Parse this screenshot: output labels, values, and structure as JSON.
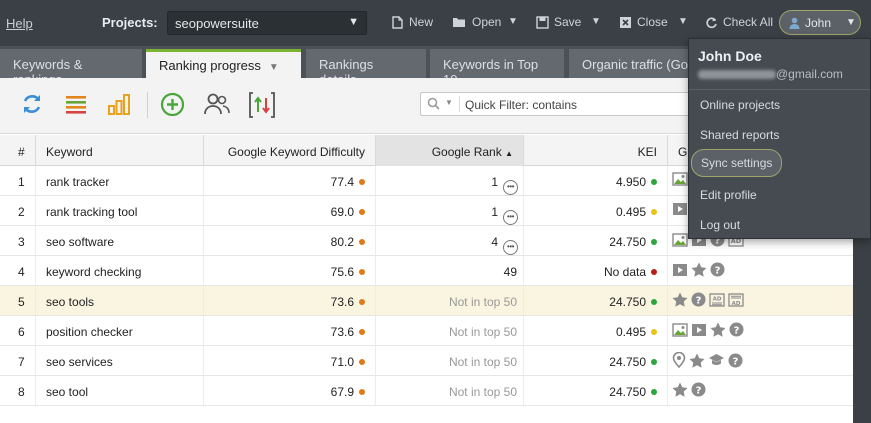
{
  "topbar": {
    "help": "Help",
    "projects_label": "Projects:",
    "project_value": "seopowersuite",
    "new": "New",
    "open": "Open",
    "save": "Save",
    "close": "Close",
    "check_all": "Check All",
    "user": "John"
  },
  "tabs": [
    {
      "label": "Keywords & rankings"
    },
    {
      "label": "Ranking progress"
    },
    {
      "label": "Rankings details"
    },
    {
      "label": "Keywords in Top 10"
    },
    {
      "label": "Organic traffic (Goo"
    }
  ],
  "filter": {
    "placeholder": "Quick Filter: contains"
  },
  "columns": {
    "num": "#",
    "keyword": "Keyword",
    "difficulty": "Google Keyword Difficulty",
    "rank": "Google Rank",
    "kei": "KEI",
    "serp": "G"
  },
  "rows": [
    {
      "n": "1",
      "keyword": "rank tracker",
      "difficulty": "77.4",
      "rank": "1",
      "kei": "4.950"
    },
    {
      "n": "2",
      "keyword": "rank tracking tool",
      "difficulty": "69.0",
      "rank": "1",
      "kei": "0.495"
    },
    {
      "n": "3",
      "keyword": "seo software",
      "difficulty": "80.2",
      "rank": "4",
      "kei": "24.750"
    },
    {
      "n": "4",
      "keyword": "keyword checking",
      "difficulty": "75.6",
      "rank": "49",
      "kei": "No data"
    },
    {
      "n": "5",
      "keyword": "seo tools",
      "difficulty": "73.6",
      "rank": "Not in top 50",
      "kei": "24.750"
    },
    {
      "n": "6",
      "keyword": "position checker",
      "difficulty": "73.6",
      "rank": "Not in top 50",
      "kei": "0.495"
    },
    {
      "n": "7",
      "keyword": "seo services",
      "difficulty": "71.0",
      "rank": "Not in top 50",
      "kei": "24.750"
    },
    {
      "n": "8",
      "keyword": "seo tool",
      "difficulty": "67.9",
      "rank": "Not in top 50",
      "kei": "24.750"
    }
  ],
  "row_status": {
    "kei_colors": [
      "#2aa63a",
      "#e8c21a",
      "#2aa63a",
      "#b81d1d",
      "#2aa63a",
      "#e8c21a",
      "#2aa63a",
      "#2aa63a"
    ],
    "difficulty_color": "#e07a16",
    "highlighted_row": 5
  },
  "serp_features": [
    [
      "image-icon"
    ],
    [
      "video-icon"
    ],
    [
      "image-icon",
      "video-icon",
      "question-icon",
      "ad-icon"
    ],
    [
      "video-icon",
      "star-icon",
      "question-icon"
    ],
    [
      "star-icon",
      "question-icon",
      "ad-top-icon",
      "ad-bottom-icon"
    ],
    [
      "image-icon",
      "video-icon",
      "star-icon",
      "question-icon"
    ],
    [
      "map-pin-icon",
      "star-icon",
      "academic-cap-icon",
      "question-icon"
    ],
    [
      "star-icon",
      "question-icon"
    ]
  ],
  "user_menu": {
    "name": "John Doe",
    "email_suffix": "@gmail.com",
    "items": [
      {
        "label": "Online projects"
      },
      {
        "label": "Shared reports"
      },
      {
        "label": "Sync settings"
      },
      {
        "label": "Edit profile"
      },
      {
        "label": "Log out"
      }
    ]
  },
  "colors": {
    "accent_green": "#7bb234",
    "toolbar_bg": "#3a4046"
  }
}
